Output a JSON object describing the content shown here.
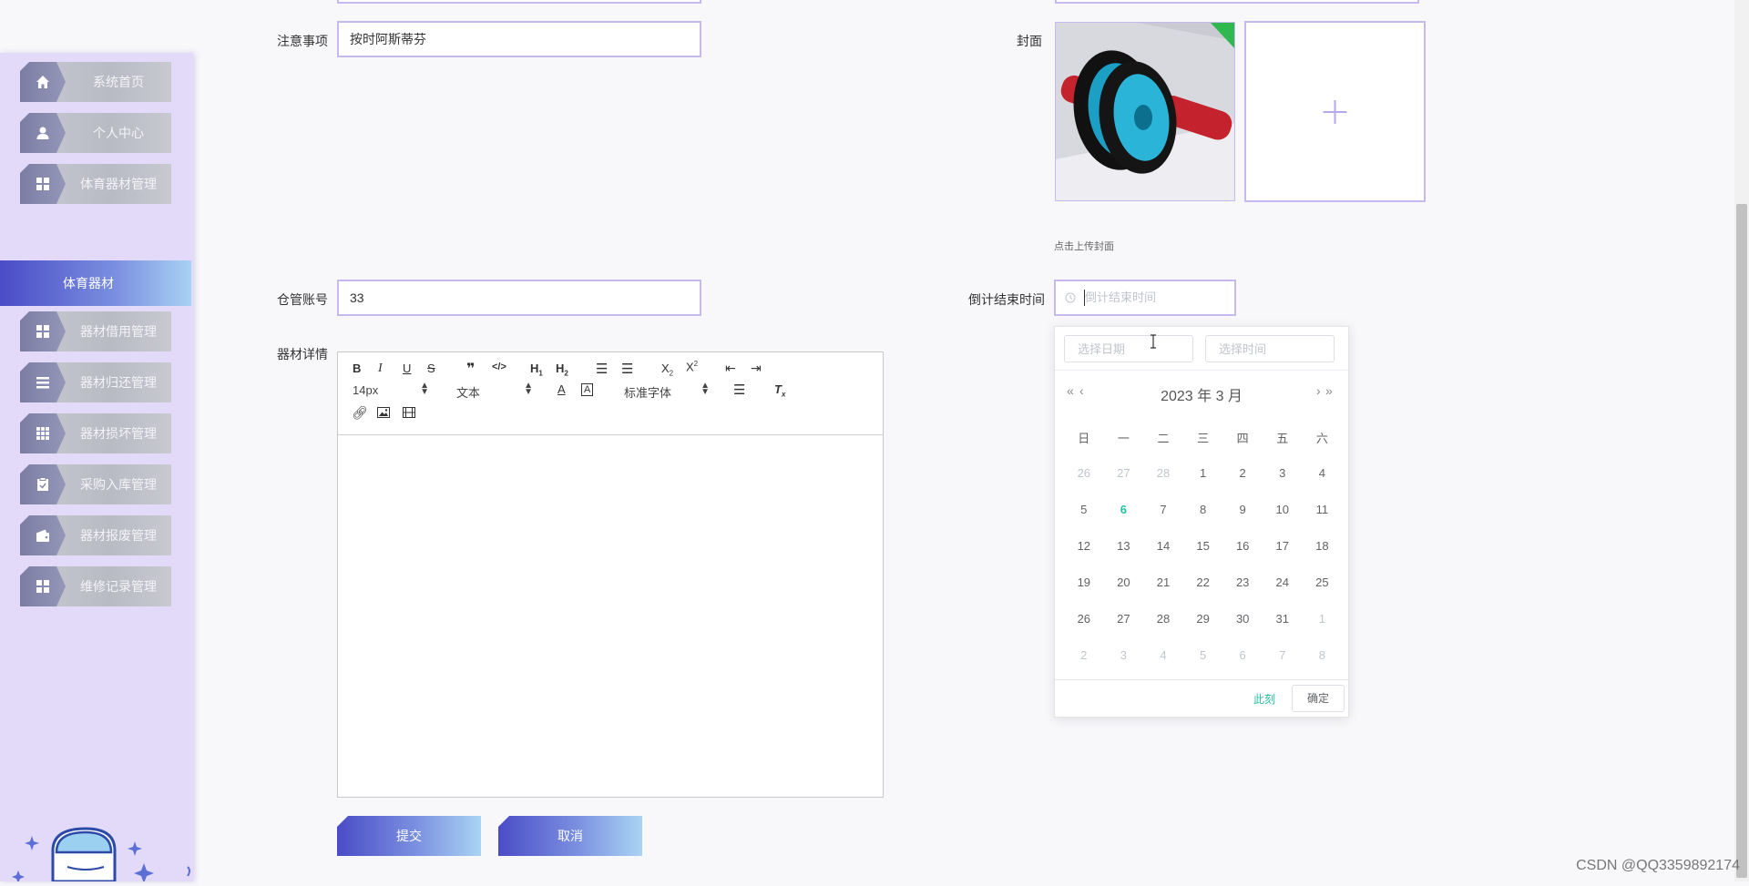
{
  "sidebar": {
    "items": [
      {
        "label": "系统首页",
        "icon": "home-icon"
      },
      {
        "label": "个人中心",
        "icon": "user-icon"
      },
      {
        "label": "体育器材管理",
        "icon": "grid-icon"
      },
      {
        "label": "器材借用管理",
        "icon": "grid-icon"
      },
      {
        "label": "器材归还管理",
        "icon": "list-icon"
      },
      {
        "label": "器材损坏管理",
        "icon": "table-icon"
      },
      {
        "label": "采购入库管理",
        "icon": "clipboard-icon"
      },
      {
        "label": "器材报废管理",
        "icon": "wallet-icon"
      },
      {
        "label": "维修记录管理",
        "icon": "grid-icon"
      }
    ],
    "active_sub": "体育器材"
  },
  "form": {
    "notes_label": "注意事项",
    "notes_value": "按时阿斯蒂芬",
    "cover_label": "封面",
    "cover_hint": "点击上传封面",
    "warehouse_label": "仓管账号",
    "warehouse_value": "33",
    "countdown_label": "倒计结束时间",
    "countdown_placeholder": "倒计结束时间",
    "detail_label": "器材详情"
  },
  "editor": {
    "font_size": "14px",
    "header_select": "文本",
    "font_family": "标准字体"
  },
  "buttons": {
    "submit": "提交",
    "cancel": "取消"
  },
  "datepicker": {
    "date_placeholder": "选择日期",
    "time_placeholder": "选择时间",
    "year_label": "2023 年",
    "month_label": "3 月",
    "weekdays": [
      "日",
      "一",
      "二",
      "三",
      "四",
      "五",
      "六"
    ],
    "weeks": [
      [
        {
          "d": "26",
          "o": true
        },
        {
          "d": "27",
          "o": true
        },
        {
          "d": "28",
          "o": true
        },
        {
          "d": "1"
        },
        {
          "d": "2"
        },
        {
          "d": "3"
        },
        {
          "d": "4"
        }
      ],
      [
        {
          "d": "5"
        },
        {
          "d": "6",
          "today": true
        },
        {
          "d": "7"
        },
        {
          "d": "8"
        },
        {
          "d": "9"
        },
        {
          "d": "10"
        },
        {
          "d": "11"
        }
      ],
      [
        {
          "d": "12"
        },
        {
          "d": "13"
        },
        {
          "d": "14"
        },
        {
          "d": "15"
        },
        {
          "d": "16"
        },
        {
          "d": "17"
        },
        {
          "d": "18"
        }
      ],
      [
        {
          "d": "19"
        },
        {
          "d": "20"
        },
        {
          "d": "21"
        },
        {
          "d": "22"
        },
        {
          "d": "23"
        },
        {
          "d": "24"
        },
        {
          "d": "25"
        }
      ],
      [
        {
          "d": "26"
        },
        {
          "d": "27"
        },
        {
          "d": "28"
        },
        {
          "d": "29"
        },
        {
          "d": "30"
        },
        {
          "d": "31"
        },
        {
          "d": "1",
          "o": true
        }
      ],
      [
        {
          "d": "2",
          "o": true
        },
        {
          "d": "3",
          "o": true
        },
        {
          "d": "4",
          "o": true
        },
        {
          "d": "5",
          "o": true
        },
        {
          "d": "6",
          "o": true
        },
        {
          "d": "7",
          "o": true
        },
        {
          "d": "8",
          "o": true
        }
      ]
    ],
    "now_label": "此刻",
    "ok_label": "确定"
  },
  "watermark": "CSDN @QQ3359892174",
  "colors": {
    "accent": "#4a4cc6",
    "sidebar_bg": "#e3daf9",
    "today": "#27c0a0",
    "input_border": "#c5b9ee"
  }
}
